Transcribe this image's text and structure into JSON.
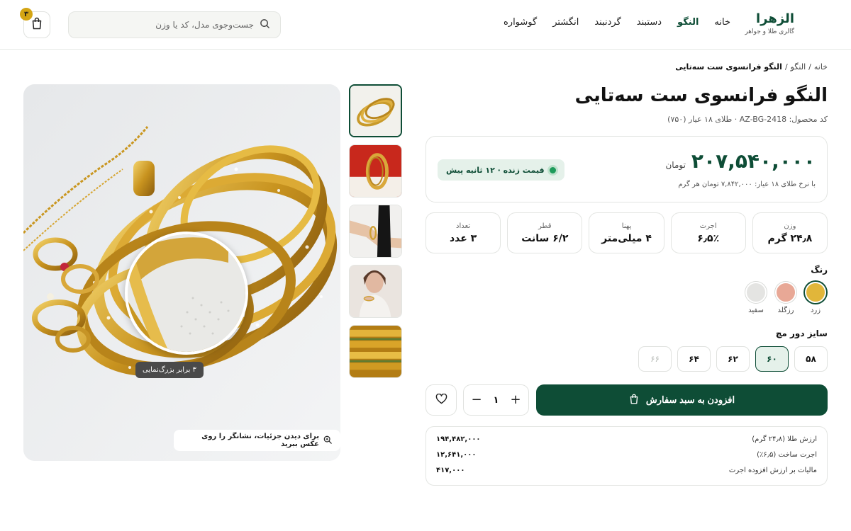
{
  "brand": {
    "name": "الزهرا",
    "tagline": "گالری طلا و جواهر"
  },
  "nav": [
    {
      "label": "خانه",
      "active": false
    },
    {
      "label": "النگو",
      "active": true
    },
    {
      "label": "دستبند",
      "active": false
    },
    {
      "label": "گردنبند",
      "active": false
    },
    {
      "label": "انگشتر",
      "active": false
    },
    {
      "label": "گوشواره",
      "active": false
    }
  ],
  "search": {
    "placeholder": "جست‌وجوی مدل، کد یا وزن"
  },
  "cart": {
    "count": "۳"
  },
  "breadcrumb": {
    "home": "خانه",
    "sep": "/",
    "category": "النگو",
    "current": "النگو فرانسوی ست سه‌تایی"
  },
  "product": {
    "title": "النگو فرانسوی ست سه‌تایی",
    "meta": "کد محصول: AZ-BG-2418 · طلای ۱۸ عیار (۷۵۰)"
  },
  "price": {
    "amount": "۲۰۷,۵۴۰,۰۰۰",
    "unit": "تومان",
    "rate_note": "با نرخ طلای ۱۸ عیار: ۷,۸۴۲,۰۰۰ تومان هر گرم",
    "live_badge": "قیمت زنده · ۱۲ ثانیه پیش"
  },
  "specs": [
    {
      "label": "وزن",
      "value": "۲۴٫۸ گرم"
    },
    {
      "label": "اجرت",
      "value": "۶٫۵٪"
    },
    {
      "label": "پهنا",
      "value": "۴ میلی‌متر"
    },
    {
      "label": "قطر",
      "value": "۶/۲ سانت"
    },
    {
      "label": "تعداد",
      "value": "۳ عدد"
    }
  ],
  "color": {
    "label": "رنگ",
    "options": [
      {
        "name": "زرد",
        "hex": "#e1b63a",
        "selected": true
      },
      {
        "name": "رزگلد",
        "hex": "#e8a896",
        "selected": false
      },
      {
        "name": "سفید",
        "hex": "#e4e4e2",
        "selected": false
      }
    ]
  },
  "size": {
    "label": "سایز دور مچ",
    "options": [
      {
        "label": "۵۸",
        "state": "normal"
      },
      {
        "label": "۶۰",
        "state": "selected"
      },
      {
        "label": "۶۲",
        "state": "normal"
      },
      {
        "label": "۶۴",
        "state": "normal"
      },
      {
        "label": "۶۶",
        "state": "disabled"
      }
    ]
  },
  "actions": {
    "add_to_cart": "افزودن به سبد سفارش",
    "quantity": "۱"
  },
  "breakdown": [
    {
      "label": "ارزش طلا (۲۴٫۸ گرم)",
      "value": "۱۹۴,۴۸۲,۰۰۰"
    },
    {
      "label": "اجرت ساخت (۶٫۵٪)",
      "value": "۱۲,۶۴۱,۰۰۰"
    },
    {
      "label": "مالیات بر ارزش افزوده اجرت",
      "value": "۴۱۷,۰۰۰"
    }
  ],
  "gallery": {
    "zoom_label": "۳ برابر بزرگ‌نمایی",
    "hint": "برای دیدن جزئیات، نشانگر را روی عکس ببرید"
  },
  "colors": {
    "primary": "#0e4d36",
    "accent_gold": "#d4a514",
    "live_bg": "#e5f1ea"
  }
}
